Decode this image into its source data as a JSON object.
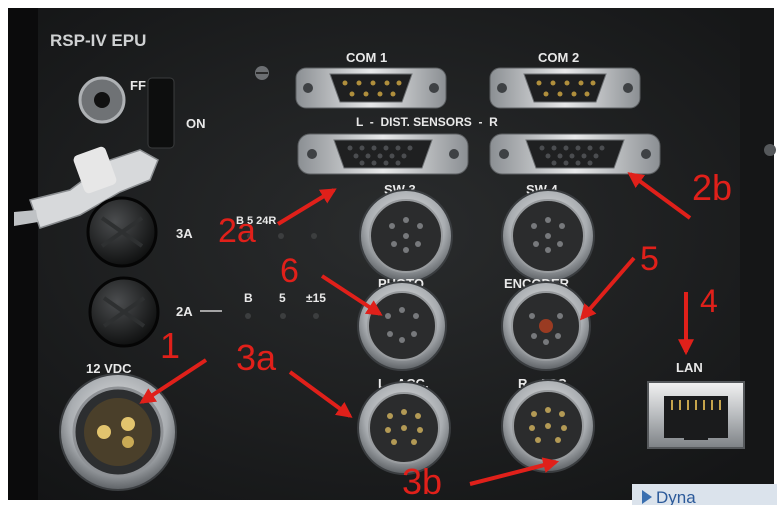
{
  "panel": {
    "model": "RSP-IV EPU",
    "switch_off": "FF",
    "switch_on": "ON",
    "fuse_top": "3A",
    "fuse_top_leds": "B  5  24R",
    "fuse_bottom": "2A",
    "fuse_bottom_leds": [
      "B",
      "5",
      "±15"
    ],
    "power_label": "12 VDC",
    "com1": "COM 1",
    "com2": "COM 2",
    "dist_sensors": "L  -  DIST. SENSORS  -  R",
    "sw3": "SW 3",
    "sw4": "SW 4",
    "photo": "PHOTO",
    "encoder": "ENCODER",
    "l_acc": "L - ACC.",
    "r_acc": "R - ACC.",
    "lan": "LAN",
    "brand": "Dyna"
  },
  "annotations": {
    "a1": "1",
    "a2a": "2a",
    "a2b": "2b",
    "a3a": "3a",
    "a3b": "3b",
    "a4": "4",
    "a5": "5",
    "a6": "6"
  },
  "colors": {
    "panel": "#1d1f20",
    "annotation": "#e0201a",
    "silkscreen": "#e9e9e9"
  }
}
